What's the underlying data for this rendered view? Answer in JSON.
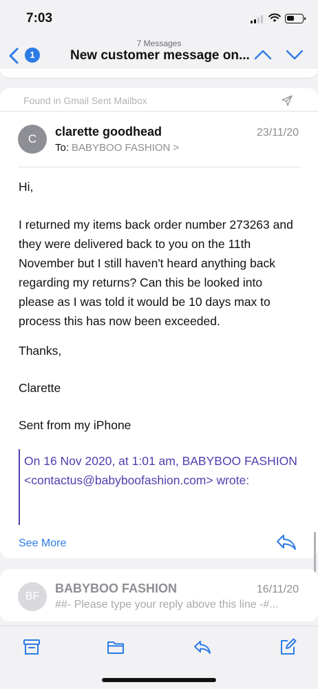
{
  "status_bar": {
    "time": "7:03",
    "battery_level": 0.5
  },
  "nav": {
    "message_count": "7 Messages",
    "title": "New customer message on...",
    "back_badge": "1",
    "accent_color": "#2c7be5"
  },
  "main_message": {
    "found_in": "Found in Gmail Sent Mailbox",
    "avatar_initial": "C",
    "sender": "clarette goodhead",
    "date": "23/11/20",
    "to_label": "To:",
    "recipient": "BABYBOO FASHION",
    "recipient_chevron": ">",
    "body": {
      "greeting": "Hi,",
      "paragraph": "I returned my items back order number 273263 and they were delivered back to you on the 11th November but I still haven't heard anything back regarding my returns? Can this be looked into please as I was told it would be 10 days max to process this has now been exceeded.",
      "thanks": "Thanks,",
      "signoff": "Clarette",
      "signature": "Sent from my iPhone"
    },
    "quote": "On 16 Nov 2020, at 1:01 am, BABYBOO FASHION <contactus@babyboofashion.com> wrote:",
    "quote_color": "#4f3fb0",
    "see_more": "See More"
  },
  "second_message": {
    "avatar_initials": "BF",
    "sender": "BABYBOO FASHION",
    "date": "16/11/20",
    "preview": "##- Please type your reply above this line -#..."
  },
  "toolbar": {
    "icons": [
      "archive-icon",
      "folder-icon",
      "reply-icon",
      "compose-icon"
    ]
  }
}
